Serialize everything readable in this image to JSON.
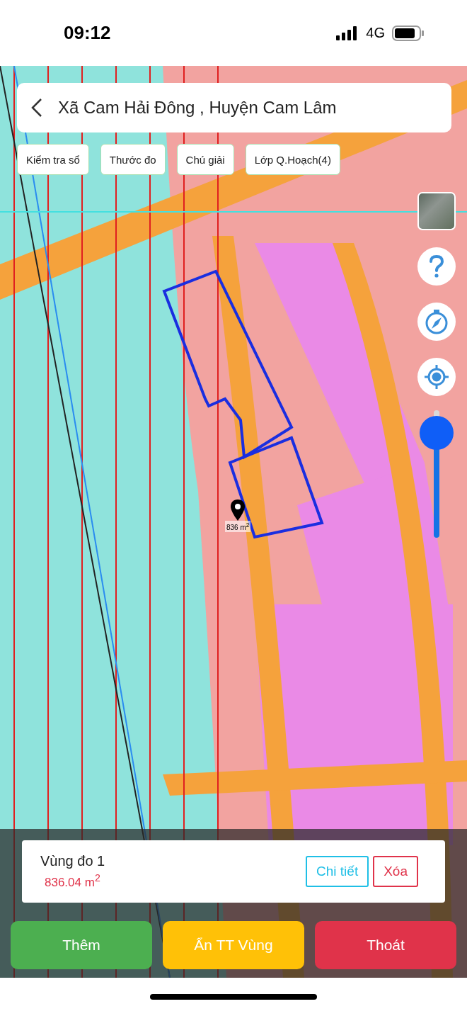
{
  "status_bar": {
    "time": "09:12",
    "network": "4G"
  },
  "header": {
    "title": "Xã Cam Hải Đông , Huyện Cam Lâm"
  },
  "toolbar": [
    "Kiểm tra sổ",
    "Thước đo",
    "Chú giải",
    "Lớp Q.Hoạch(4)"
  ],
  "map": {
    "area_label": "836 m$^{2}$"
  },
  "zoom_slider": {
    "level": 0.82
  },
  "measure_card": {
    "name": "Vùng đo 1",
    "area": "836.04 m$^{2}$",
    "buttons": [
      {
        "label": "Chi tiết",
        "kind": "detail"
      },
      {
        "label": "Xóa",
        "kind": "delete"
      }
    ]
  },
  "actions": [
    {
      "label": "Thêm",
      "kind": "add"
    },
    {
      "label": "Ẩn TT Vùng",
      "kind": "hide"
    },
    {
      "label": "Thoát",
      "kind": "exit"
    }
  ]
}
